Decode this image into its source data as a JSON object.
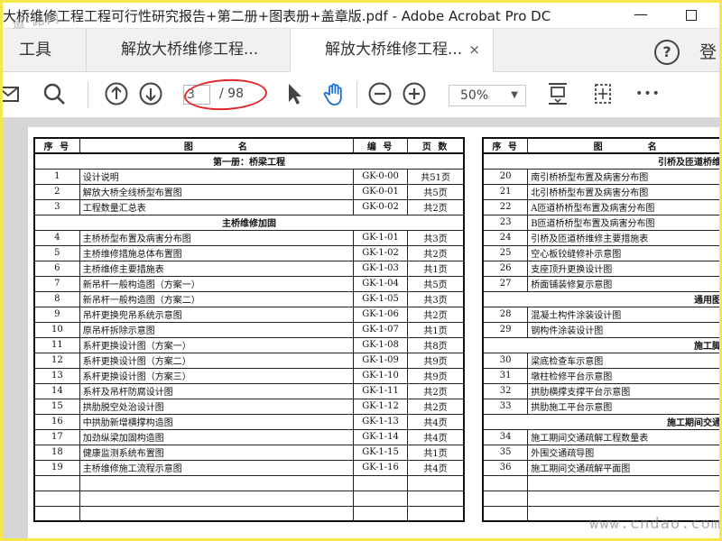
{
  "window": {
    "title": "大桥维修工程工程可行性研究报告+第二册+图表册+盖章版.pdf - Adobe Acrobat Pro DC",
    "minimize": "—"
  },
  "watermarks": {
    "top": "道·路网",
    "bottom": "www.cndao.com"
  },
  "tabs": {
    "tools": "工具",
    "items": [
      {
        "label": "解放大桥维修工程..."
      },
      {
        "label": "解放大桥维修工程..."
      }
    ],
    "close": "×",
    "help": "?",
    "login": "登"
  },
  "toolbar": {
    "page_current": "3",
    "page_total": "/ 98",
    "zoom": "50%",
    "more": "•••",
    "icons": [
      "mail-icon",
      "search-icon",
      "page-up-icon",
      "page-down-icon",
      "select-cursor-icon",
      "hand-tool-icon",
      "zoom-out-icon",
      "zoom-in-icon",
      "fit-page-icon",
      "scroll-mode-icon",
      "more-icon"
    ],
    "annotation_color": "#e0262b"
  },
  "toc": {
    "headers": {
      "no": "序 号",
      "name": "图　　　　名",
      "code": "编 号",
      "pages": "页 数"
    },
    "left": [
      {
        "type": "section",
        "text": "第一册：桥梁工程"
      },
      {
        "no": "1",
        "name": "设计说明",
        "code": "GK-0-00",
        "pages": "共51页"
      },
      {
        "no": "2",
        "name": "解放大桥全线桥型布置图",
        "code": "GK-0-01",
        "pages": "共5页"
      },
      {
        "no": "3",
        "name": "工程数量汇总表",
        "code": "GK-0-02",
        "pages": "共2页"
      },
      {
        "type": "section",
        "text": "主桥维修加固"
      },
      {
        "no": "4",
        "name": "主桥桥型布置及病害分布图",
        "code": "GK-1-01",
        "pages": "共3页"
      },
      {
        "no": "5",
        "name": "主桥维修措施总体布置图",
        "code": "GK-1-02",
        "pages": "共2页"
      },
      {
        "no": "6",
        "name": "主桥维修主要措施表",
        "code": "GK-1-03",
        "pages": "共1页"
      },
      {
        "no": "7",
        "name": "新吊杆一般构造图（方案一）",
        "code": "GK-1-04",
        "pages": "共5页"
      },
      {
        "no": "8",
        "name": "新吊杆一般构造图（方案二）",
        "code": "GK-1-05",
        "pages": "共3页"
      },
      {
        "no": "9",
        "name": "吊杆更换兜吊系统示意图",
        "code": "GK-1-06",
        "pages": "共2页"
      },
      {
        "no": "10",
        "name": "原吊杆拆除示意图",
        "code": "GK-1-07",
        "pages": "共1页"
      },
      {
        "no": "11",
        "name": "系杆更换设计图（方案一）",
        "code": "GK-1-08",
        "pages": "共8页"
      },
      {
        "no": "12",
        "name": "系杆更换设计图（方案二）",
        "code": "GK-1-09",
        "pages": "共9页"
      },
      {
        "no": "13",
        "name": "系杆更换设计图（方案三）",
        "code": "GK-1-10",
        "pages": "共9页"
      },
      {
        "no": "14",
        "name": "系杆及吊杆防腐设计图",
        "code": "GK-1-11",
        "pages": "共2页"
      },
      {
        "no": "15",
        "name": "拱肋脱空处治设计图",
        "code": "GK-1-12",
        "pages": "共2页"
      },
      {
        "no": "16",
        "name": "中拱肋新增横撑构造图",
        "code": "GK-1-13",
        "pages": "共4页"
      },
      {
        "no": "17",
        "name": "加劲纵梁加固构造图",
        "code": "GK-1-14",
        "pages": "共4页"
      },
      {
        "no": "18",
        "name": "健康监测系统布置图",
        "code": "GK-1-15",
        "pages": "共1页"
      },
      {
        "no": "19",
        "name": "主桥维修施工流程示意图",
        "code": "GK-1-16",
        "pages": "共4页"
      },
      {
        "type": "blank"
      },
      {
        "type": "blank"
      },
      {
        "type": "blank"
      }
    ],
    "right": [
      {
        "type": "section",
        "text": "引桥及匝道桥维"
      },
      {
        "no": "20",
        "name": "南引桥桥型布置及病害分布图"
      },
      {
        "no": "21",
        "name": "北引桥桥型布置及病害分布图"
      },
      {
        "no": "22",
        "name": "A匝道桥桥型布置及病害分布图"
      },
      {
        "no": "23",
        "name": "B匝道桥桥型布置及病害分布图"
      },
      {
        "no": "24",
        "name": "引桥及匝道桥维修主要措施表"
      },
      {
        "no": "25",
        "name": "空心板铰缝修补示意图"
      },
      {
        "no": "26",
        "name": "支座顶升更换设计图"
      },
      {
        "no": "27",
        "name": "桥面铺装修复示意图"
      },
      {
        "type": "section",
        "text": "通用图"
      },
      {
        "no": "28",
        "name": "混凝土构件涂装设计图"
      },
      {
        "no": "29",
        "name": "钢构件涂装设计图"
      },
      {
        "type": "section",
        "text": "施工脚"
      },
      {
        "no": "30",
        "name": "梁底检查车示意图"
      },
      {
        "no": "31",
        "name": "墩柱检修平台示意图"
      },
      {
        "no": "32",
        "name": "拱肋横撑支撑平台示意图"
      },
      {
        "no": "33",
        "name": "拱肋施工平台示意图"
      },
      {
        "type": "section",
        "text": "施工期间交通"
      },
      {
        "no": "34",
        "name": "施工期间交通疏解工程数量表"
      },
      {
        "no": "35",
        "name": "外围交通疏导图"
      },
      {
        "no": "36",
        "name": "施工期间交通疏解平面图"
      },
      {
        "type": "blank"
      },
      {
        "type": "blank"
      },
      {
        "type": "blank"
      }
    ]
  }
}
